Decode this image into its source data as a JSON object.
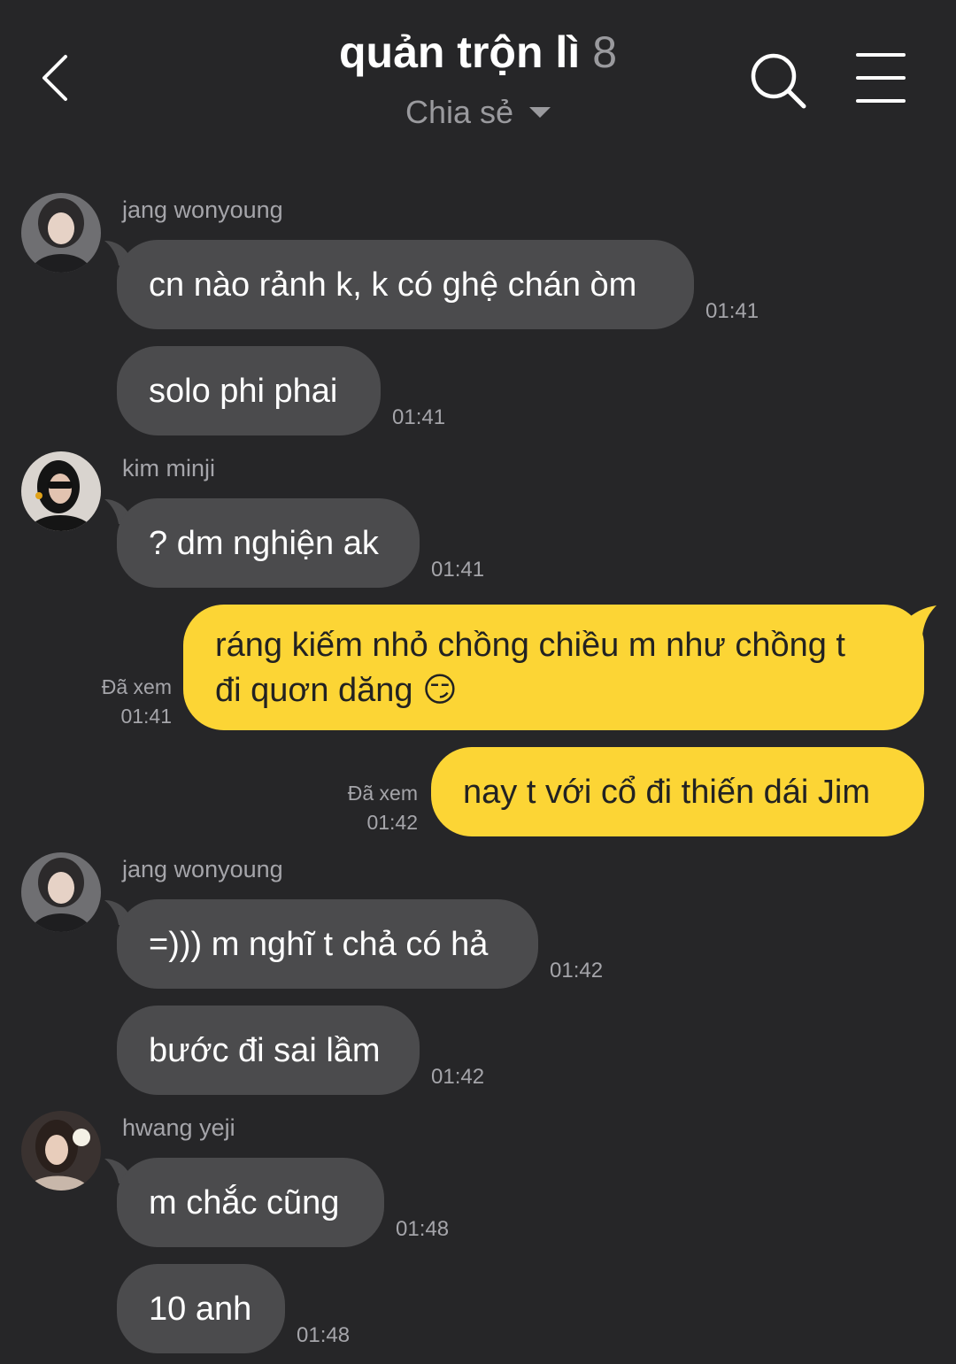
{
  "header": {
    "title": "quản trộn lì",
    "member_count": "8",
    "subtitle": "Chia sẻ",
    "back_icon": "chevron-left-icon",
    "search_icon": "search-icon",
    "menu_icon": "menu-icon"
  },
  "colors": {
    "background": "#262628",
    "incoming_bubble": "#4b4b4d",
    "outgoing_bubble": "#fcd535",
    "muted_text": "#a5a5aa"
  },
  "messages": [
    {
      "sender": "jang wonyoung",
      "text": "cn nào rảnh k, k có ghệ chán òm",
      "time": "01:41"
    },
    {
      "text": "solo phi phai",
      "time": "01:41"
    },
    {
      "sender": "kim minji",
      "text": "? dm nghiện ak",
      "time": "01:41"
    },
    {
      "own": true,
      "line1": "ráng kiếm nhỏ chồng chiều m như chồng t",
      "line2": "đi quơn dăng",
      "emoji": "😏",
      "seen": "Đã xem",
      "time": "01:41"
    },
    {
      "own": true,
      "text": "nay t với cổ đi thiến dái Jim",
      "seen": "Đã xem",
      "time": "01:42"
    },
    {
      "sender": "jang wonyoung",
      "text": "=))) m nghĩ t chả có hả",
      "time": "01:42"
    },
    {
      "text": "bước đi sai lầm",
      "time": "01:42"
    },
    {
      "sender": "hwang yeji",
      "text": "m chắc cũng",
      "time": "01:48"
    },
    {
      "text": "10 anh",
      "time": "01:48"
    }
  ]
}
